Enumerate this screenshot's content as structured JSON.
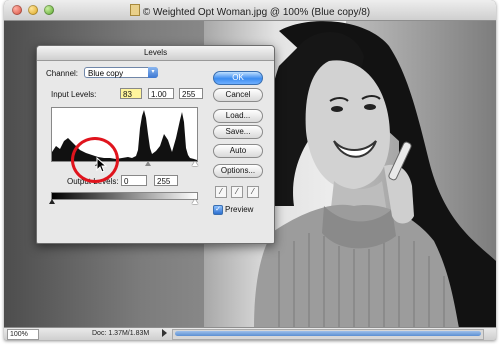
{
  "document": {
    "title": "© Weighted Opt Woman.jpg @ 100% (Blue copy/8)",
    "zoom": "100%",
    "status": "Doc: 1.37M/1.83M"
  },
  "levels_dialog": {
    "title": "Levels",
    "channel_label": "Channel:",
    "channel_value": "Blue copy",
    "input_levels_label": "Input Levels:",
    "input_black": "83",
    "input_gamma": "1.00",
    "input_white": "255",
    "output_levels_label": "Output Levels:",
    "output_black": "0",
    "output_white": "255",
    "buttons": {
      "ok": "OK",
      "cancel": "Cancel",
      "load": "Load...",
      "save": "Save...",
      "auto": "Auto",
      "options": "Options..."
    },
    "preview_label": "Preview",
    "preview_checked": true,
    "annotation_color": "#e0141d"
  },
  "icons": [
    "file-icon",
    "close-icon",
    "minimize-icon",
    "zoom-icon",
    "chevron-updown-icon",
    "black-eyedropper-icon",
    "gray-eyedropper-icon",
    "white-eyedropper-icon",
    "checkmark-icon",
    "arrow-cursor-icon"
  ]
}
